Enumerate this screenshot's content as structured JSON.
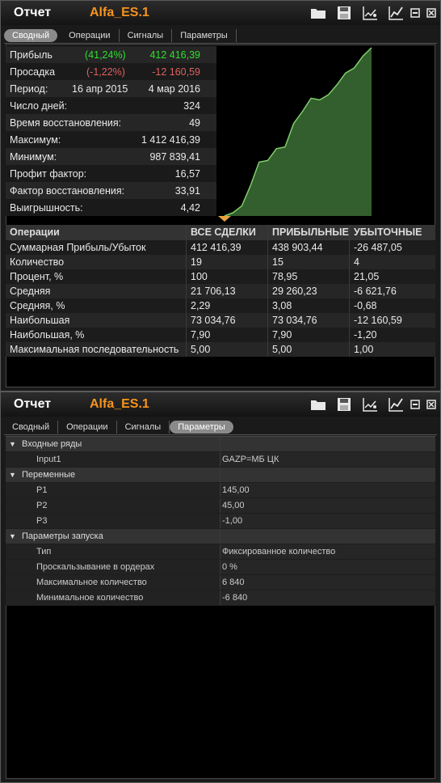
{
  "window1": {
    "title": "Отчет",
    "instrument": "Alfa_ES.1",
    "tabs": [
      "Сводный",
      "Операции",
      "Сигналы",
      "Параметры"
    ],
    "active_tab": 0
  },
  "stats": {
    "rows": [
      {
        "label": "Прибыль",
        "pct": "(41,24%)",
        "value": "412 416,39",
        "tone": "green"
      },
      {
        "label": "Просадка",
        "pct": "(-1,22%)",
        "value": "-12 160,59",
        "tone": "red"
      },
      {
        "label": "Период:",
        "from": "16 апр 2015",
        "value": "4 мар 2016"
      },
      {
        "label": "Число дней:",
        "value": "324"
      },
      {
        "label": "Время восстановления:",
        "value": "49"
      },
      {
        "label": "Максимум:",
        "value": "1 412 416,39"
      },
      {
        "label": "Минимум:",
        "value": "987 839,41"
      },
      {
        "label": "Профит фактор:",
        "value": "16,57"
      },
      {
        "label": "Фактор восстановления:",
        "value": "33,91"
      },
      {
        "label": "Выигрышность:",
        "value": "4,42"
      }
    ]
  },
  "operations_table": {
    "headers": [
      "Операции",
      "ВСЕ СДЕЛКИ",
      "ПРИБЫЛЬНЫЕ",
      "УБЫТОЧНЫЕ"
    ],
    "rows": [
      [
        "Суммарная Прибыль/Убыток",
        "412 416,39",
        "438 903,44",
        "-26 487,05"
      ],
      [
        "Количество",
        "19",
        "15",
        "4"
      ],
      [
        "Процент, %",
        "100",
        "78,95",
        "21,05"
      ],
      [
        "Средняя",
        "21 706,13",
        "29 260,23",
        "-6 621,76"
      ],
      [
        "Средняя, %",
        "2,29",
        "3,08",
        "-0,68"
      ],
      [
        "Наибольшая",
        "73 034,76",
        "73 034,76",
        "-12 160,59"
      ],
      [
        "Наибольшая, %",
        "7,90",
        "7,90",
        "-1,20"
      ],
      [
        "Максимальная последовательность",
        "5,00",
        "5,00",
        "1,00"
      ]
    ]
  },
  "equity_chart": {
    "values": [
      0,
      2,
      6,
      18,
      32,
      33,
      40,
      41,
      55,
      62,
      70,
      69,
      72,
      78,
      85,
      88,
      95,
      100
    ],
    "line_color": "#7fcf6a",
    "fill_color": "#3c6e35",
    "marker_color": "#e8a040"
  },
  "window2": {
    "title": "Отчет",
    "instrument": "Alfa_ES.1",
    "tabs": [
      "Сводный",
      "Операции",
      "Сигналы",
      "Параметры"
    ],
    "active_tab": 3
  },
  "params": {
    "groups": [
      {
        "name": "Входные ряды",
        "items": [
          {
            "name": "Input1",
            "value": "GAZP=МБ ЦК"
          }
        ]
      },
      {
        "name": "Переменные",
        "items": [
          {
            "name": "P1",
            "value": "145,00"
          },
          {
            "name": "P2",
            "value": "45,00"
          },
          {
            "name": "P3",
            "value": "-1,00"
          }
        ]
      },
      {
        "name": "Параметры запуска",
        "items": [
          {
            "name": "Тип",
            "value": "Фиксированное количество"
          },
          {
            "name": "Проскальзывание в ордерах",
            "value": "0 %"
          },
          {
            "name": "Максимальное количество",
            "value": "6 840"
          },
          {
            "name": "Минимальное количество",
            "value": "-6 840"
          }
        ]
      }
    ]
  },
  "icons": [
    "folder-icon",
    "save-icon",
    "chart-settings-icon",
    "equity-chart-icon",
    "minimize-icon",
    "close-icon"
  ]
}
